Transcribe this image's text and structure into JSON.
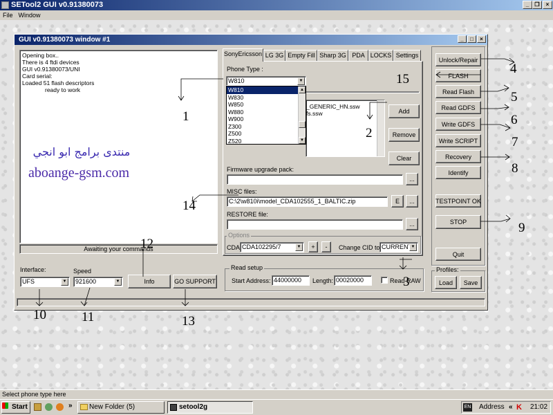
{
  "outer_window": {
    "title": "SETool2 GUI v0.91380073",
    "menu": [
      "File",
      "Window"
    ]
  },
  "app_window": {
    "title": "GUI v0.91380073 window #1"
  },
  "log": {
    "lines": [
      "Opening box..",
      "There is 4 ftdi devices",
      "GUI v0.91380073/UNI",
      "Card serial:",
      "Loaded 51 flash descriptors",
      "ready to work"
    ],
    "status": "Awaiting your commands",
    "watermark_arabic": "منتدى برامج ابو انجي",
    "watermark_url": "aboange-gsm.com"
  },
  "tabs": [
    "SonyEricsson",
    "LG 3G",
    "Empty Fill",
    "Sharp 3G",
    "PDA",
    "LOCKS",
    "Settings"
  ],
  "phone_type": {
    "label": "Phone Type :",
    "value": "W810",
    "options": [
      "W810",
      "W830",
      "W850",
      "W880",
      "W900",
      "Z300",
      "Z500",
      "Z520"
    ]
  },
  "files": {
    "items": [
      "_GENERIC_HN.ssw",
      "fs.ssw"
    ]
  },
  "buttons_mid": {
    "add": "Add",
    "remove": "Remove",
    "clear": "Clear"
  },
  "firmware": {
    "label": "Firmware upgrade pack:",
    "value": ""
  },
  "misc": {
    "label": "MISC files:",
    "value": "C:\\2\\w810i\\model_CDA102555_1_BALTIC.zip",
    "e_btn": "E"
  },
  "restore": {
    "label": "RESTORE file:",
    "value": ""
  },
  "options": {
    "label": "Options",
    "cda_label": "CDA",
    "cda_value": "CDA102295/7",
    "plus": "+",
    "minus": "-",
    "cid_label": "Change CID to",
    "cid_value": "CURRENT"
  },
  "read_setup": {
    "label": "Read setup",
    "start_label": "Start Address:",
    "start_value": "44000000",
    "length_label": "Length:",
    "length_value": "00020000",
    "check_label": "Read RAW"
  },
  "right_buttons": [
    "Unlock/Repair",
    "FLASH",
    "Read Flash",
    "Read GDFS",
    "Write GDFS",
    "Write SCRIPT",
    "Recovery",
    "Identify",
    "TESTPOINT OK",
    "STOP",
    "Quit"
  ],
  "profiles": {
    "label": "Profiles:",
    "load": "Load",
    "save": "Save"
  },
  "bottom": {
    "interface_label": "Interface:",
    "interface_value": "UFS",
    "speed_label": "Speed",
    "speed_value": "921600",
    "info": "Info",
    "support": "GO SUPPORT"
  },
  "annotations": [
    "1",
    "2",
    "3",
    "4",
    "5",
    "6",
    "7",
    "8",
    "9",
    "10",
    "11",
    "12",
    "13",
    "14",
    "15"
  ],
  "status_bar": "Select phone type here",
  "taskbar": {
    "start": "Start",
    "items": [
      "New Folder (5)",
      "setool2g"
    ],
    "address": "Address",
    "time": "21:02"
  }
}
